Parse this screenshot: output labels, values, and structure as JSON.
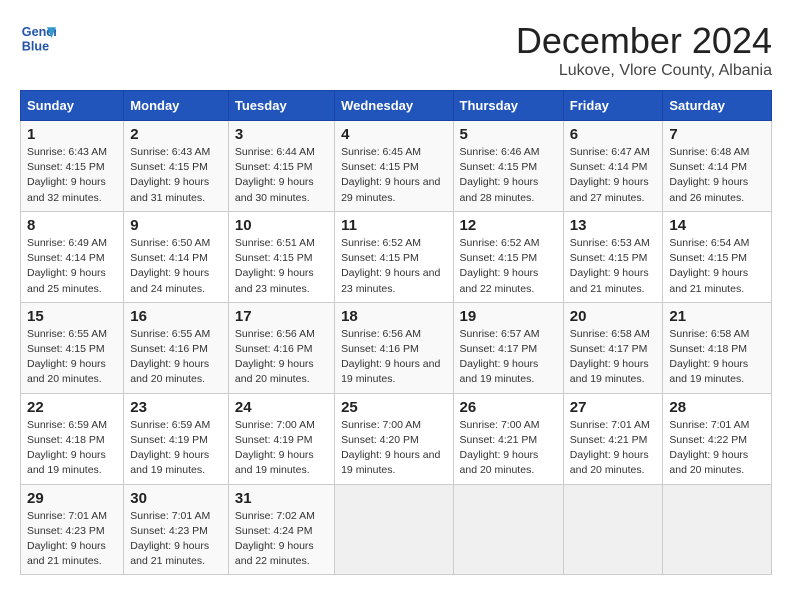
{
  "header": {
    "logo_line1": "General",
    "logo_line2": "Blue",
    "month": "December 2024",
    "location": "Lukove, Vlore County, Albania"
  },
  "weekdays": [
    "Sunday",
    "Monday",
    "Tuesday",
    "Wednesday",
    "Thursday",
    "Friday",
    "Saturday"
  ],
  "weeks": [
    [
      {
        "day": "1",
        "sunrise": "6:43 AM",
        "sunset": "4:15 PM",
        "daylight": "9 hours and 32 minutes."
      },
      {
        "day": "2",
        "sunrise": "6:43 AM",
        "sunset": "4:15 PM",
        "daylight": "9 hours and 31 minutes."
      },
      {
        "day": "3",
        "sunrise": "6:44 AM",
        "sunset": "4:15 PM",
        "daylight": "9 hours and 30 minutes."
      },
      {
        "day": "4",
        "sunrise": "6:45 AM",
        "sunset": "4:15 PM",
        "daylight": "9 hours and 29 minutes."
      },
      {
        "day": "5",
        "sunrise": "6:46 AM",
        "sunset": "4:15 PM",
        "daylight": "9 hours and 28 minutes."
      },
      {
        "day": "6",
        "sunrise": "6:47 AM",
        "sunset": "4:14 PM",
        "daylight": "9 hours and 27 minutes."
      },
      {
        "day": "7",
        "sunrise": "6:48 AM",
        "sunset": "4:14 PM",
        "daylight": "9 hours and 26 minutes."
      }
    ],
    [
      {
        "day": "8",
        "sunrise": "6:49 AM",
        "sunset": "4:14 PM",
        "daylight": "9 hours and 25 minutes."
      },
      {
        "day": "9",
        "sunrise": "6:50 AM",
        "sunset": "4:14 PM",
        "daylight": "9 hours and 24 minutes."
      },
      {
        "day": "10",
        "sunrise": "6:51 AM",
        "sunset": "4:15 PM",
        "daylight": "9 hours and 23 minutes."
      },
      {
        "day": "11",
        "sunrise": "6:52 AM",
        "sunset": "4:15 PM",
        "daylight": "9 hours and 23 minutes."
      },
      {
        "day": "12",
        "sunrise": "6:52 AM",
        "sunset": "4:15 PM",
        "daylight": "9 hours and 22 minutes."
      },
      {
        "day": "13",
        "sunrise": "6:53 AM",
        "sunset": "4:15 PM",
        "daylight": "9 hours and 21 minutes."
      },
      {
        "day": "14",
        "sunrise": "6:54 AM",
        "sunset": "4:15 PM",
        "daylight": "9 hours and 21 minutes."
      }
    ],
    [
      {
        "day": "15",
        "sunrise": "6:55 AM",
        "sunset": "4:15 PM",
        "daylight": "9 hours and 20 minutes."
      },
      {
        "day": "16",
        "sunrise": "6:55 AM",
        "sunset": "4:16 PM",
        "daylight": "9 hours and 20 minutes."
      },
      {
        "day": "17",
        "sunrise": "6:56 AM",
        "sunset": "4:16 PM",
        "daylight": "9 hours and 20 minutes."
      },
      {
        "day": "18",
        "sunrise": "6:56 AM",
        "sunset": "4:16 PM",
        "daylight": "9 hours and 19 minutes."
      },
      {
        "day": "19",
        "sunrise": "6:57 AM",
        "sunset": "4:17 PM",
        "daylight": "9 hours and 19 minutes."
      },
      {
        "day": "20",
        "sunrise": "6:58 AM",
        "sunset": "4:17 PM",
        "daylight": "9 hours and 19 minutes."
      },
      {
        "day": "21",
        "sunrise": "6:58 AM",
        "sunset": "4:18 PM",
        "daylight": "9 hours and 19 minutes."
      }
    ],
    [
      {
        "day": "22",
        "sunrise": "6:59 AM",
        "sunset": "4:18 PM",
        "daylight": "9 hours and 19 minutes."
      },
      {
        "day": "23",
        "sunrise": "6:59 AM",
        "sunset": "4:19 PM",
        "daylight": "9 hours and 19 minutes."
      },
      {
        "day": "24",
        "sunrise": "7:00 AM",
        "sunset": "4:19 PM",
        "daylight": "9 hours and 19 minutes."
      },
      {
        "day": "25",
        "sunrise": "7:00 AM",
        "sunset": "4:20 PM",
        "daylight": "9 hours and 19 minutes."
      },
      {
        "day": "26",
        "sunrise": "7:00 AM",
        "sunset": "4:21 PM",
        "daylight": "9 hours and 20 minutes."
      },
      {
        "day": "27",
        "sunrise": "7:01 AM",
        "sunset": "4:21 PM",
        "daylight": "9 hours and 20 minutes."
      },
      {
        "day": "28",
        "sunrise": "7:01 AM",
        "sunset": "4:22 PM",
        "daylight": "9 hours and 20 minutes."
      }
    ],
    [
      {
        "day": "29",
        "sunrise": "7:01 AM",
        "sunset": "4:23 PM",
        "daylight": "9 hours and 21 minutes."
      },
      {
        "day": "30",
        "sunrise": "7:01 AM",
        "sunset": "4:23 PM",
        "daylight": "9 hours and 21 minutes."
      },
      {
        "day": "31",
        "sunrise": "7:02 AM",
        "sunset": "4:24 PM",
        "daylight": "9 hours and 22 minutes."
      },
      null,
      null,
      null,
      null
    ]
  ]
}
